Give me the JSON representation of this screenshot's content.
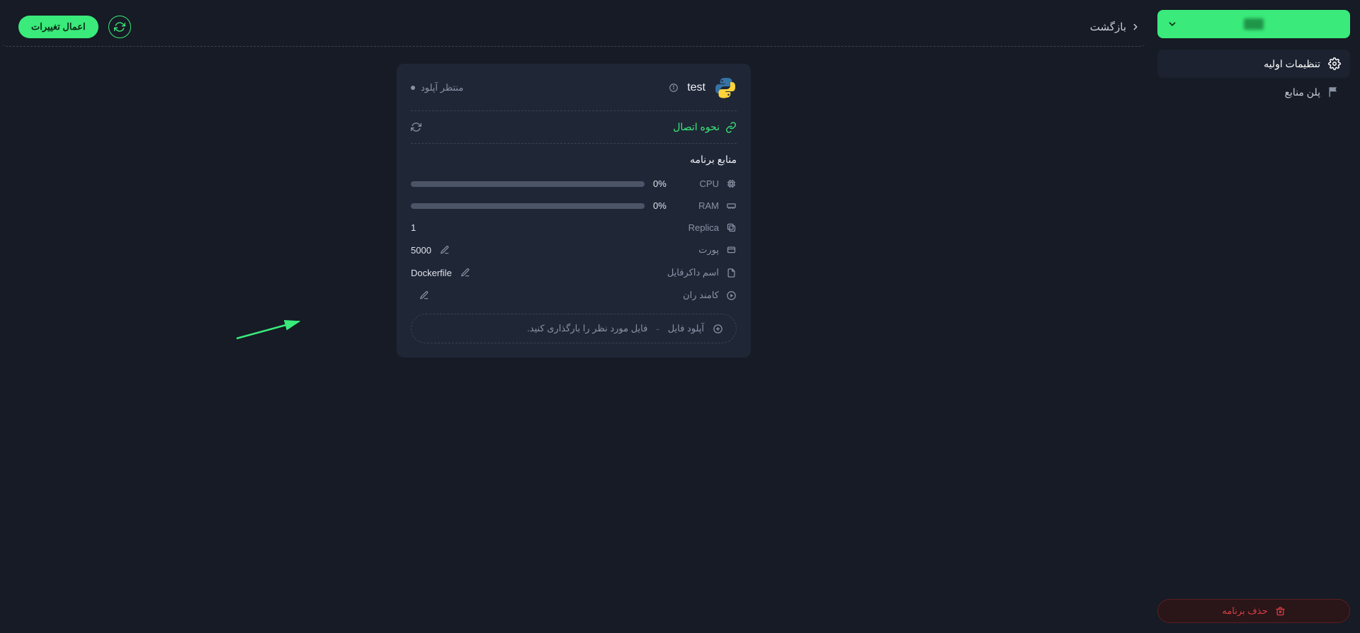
{
  "sidebar": {
    "project_logo_alt": "pachim",
    "nav": {
      "initial_settings": {
        "label": "تنظیمات اولیه"
      },
      "resources_plan": {
        "label": "پلن منابع"
      }
    },
    "delete_label": "حذف برنامه"
  },
  "topbar": {
    "back_label": "بازگشت",
    "apply_label": "اعمال تغییرات"
  },
  "app": {
    "name": "test",
    "status_label": "منتظر آپلود",
    "connection": {
      "label": "نحوه اتصال"
    },
    "resources_title": "منابع برنامه",
    "metrics": {
      "cpu": {
        "label": "CPU",
        "percent_text": "0%",
        "percent": 0
      },
      "ram": {
        "label": "RAM",
        "percent_text": "0%",
        "percent": 0
      },
      "replica": {
        "label": "Replica",
        "value": "1"
      },
      "port": {
        "label": "پورت",
        "value": "5000"
      },
      "dockerfile": {
        "label": "اسم داکرفایل",
        "value": "Dockerfile"
      },
      "command": {
        "label": "کامند ران",
        "value": ""
      }
    },
    "upload": {
      "title": "آپلود فایل",
      "hint": "فایل مورد نظر را بارگذاری کنید."
    }
  },
  "colors": {
    "green": "#3aea7a"
  }
}
